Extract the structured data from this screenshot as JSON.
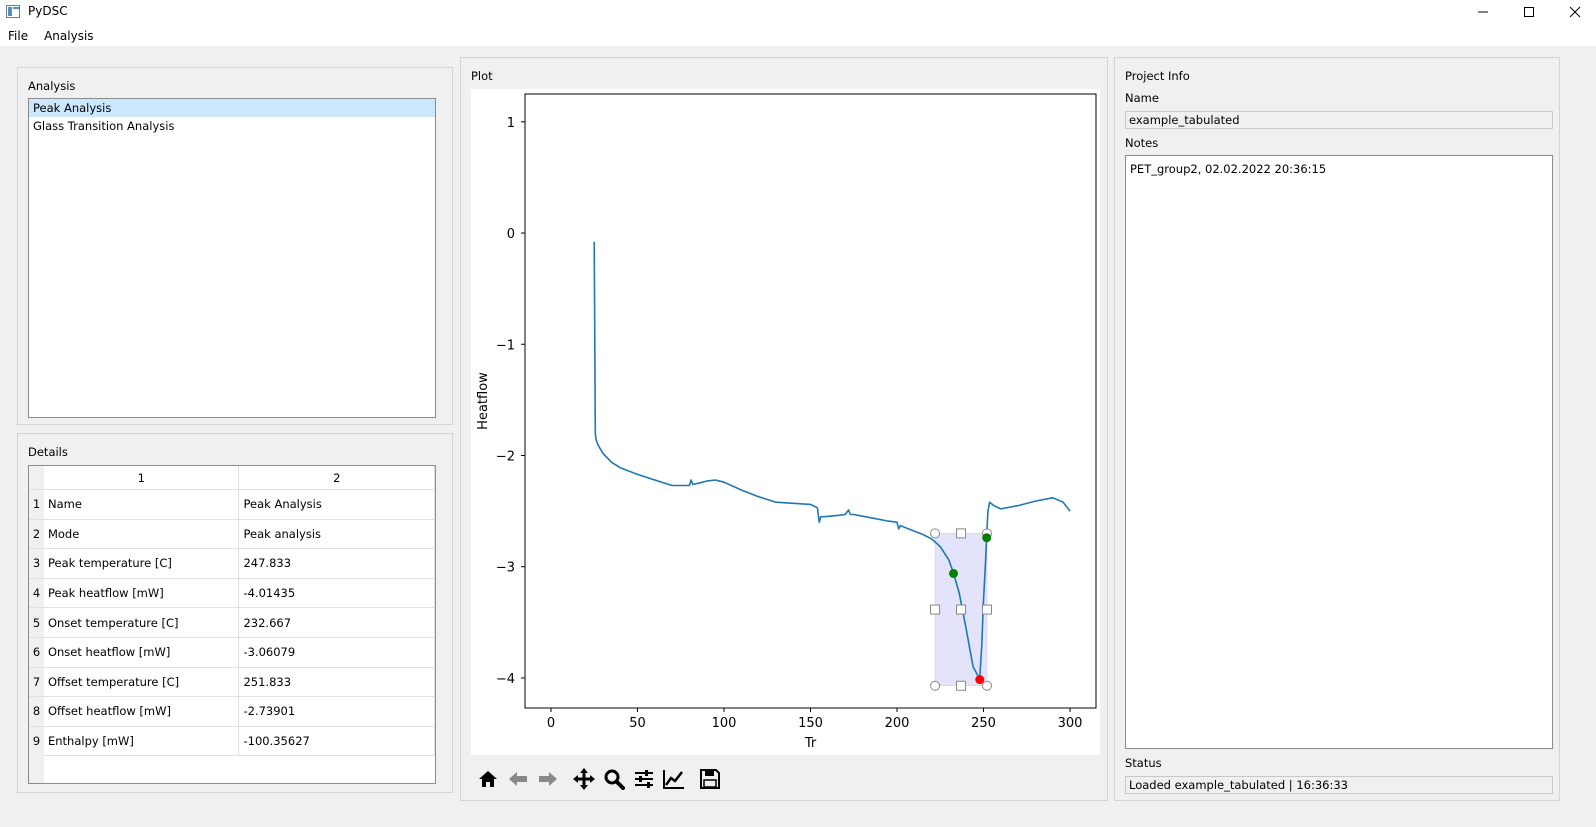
{
  "window": {
    "title": "PyDSC",
    "minimize_glyph": "—",
    "maximize_glyph": "☐",
    "close_glyph": "✕"
  },
  "menu": [
    "File",
    "Analysis"
  ],
  "analysis_panel": {
    "label": "Analysis",
    "items": [
      {
        "label": "Peak Analysis",
        "selected": true
      },
      {
        "label": "Glass Transition Analysis",
        "selected": false
      }
    ]
  },
  "details_panel": {
    "label": "Details",
    "columns": [
      "1",
      "2"
    ],
    "rows": [
      {
        "num": "1",
        "key": "Name",
        "value": "Peak Analysis"
      },
      {
        "num": "2",
        "key": "Mode",
        "value": "Peak analysis"
      },
      {
        "num": "3",
        "key": "Peak temperature [C]",
        "value": "247.833"
      },
      {
        "num": "4",
        "key": "Peak heatflow [mW]",
        "value": "-4.01435"
      },
      {
        "num": "5",
        "key": "Onset temperature [C]",
        "value": "232.667"
      },
      {
        "num": "6",
        "key": "Onset heatflow [mW]",
        "value": "-3.06079"
      },
      {
        "num": "7",
        "key": "Offset temperature [C]",
        "value": "251.833"
      },
      {
        "num": "8",
        "key": "Offset heatflow [mW]",
        "value": "-2.73901"
      },
      {
        "num": "9",
        "key": "Enthalpy [mW]",
        "value": "-100.35627"
      }
    ]
  },
  "plot_panel": {
    "label": "Plot"
  },
  "chart_data": {
    "type": "line",
    "xlabel": "Tr",
    "ylabel": "Heatflow",
    "xlim": [
      -15,
      315
    ],
    "ylim": [
      -4.27,
      1.25
    ],
    "xticks": [
      0,
      50,
      100,
      150,
      200,
      250,
      300
    ],
    "yticks": [
      1,
      0,
      -1,
      -2,
      -3,
      -4
    ],
    "line_color": "#1f77b4",
    "series": [
      {
        "x": [
          25,
          25.3,
          25.6,
          26,
          27,
          30,
          35,
          40,
          50,
          60,
          70,
          80,
          81,
          82,
          85,
          90,
          95,
          100,
          110,
          120,
          130,
          140,
          150,
          154,
          155,
          156,
          158,
          165,
          170,
          172,
          173,
          175,
          185,
          195,
          200,
          201,
          202,
          205,
          210,
          215,
          220,
          225,
          230,
          232.7,
          236,
          240,
          244,
          247.8,
          249,
          250,
          251,
          251.8,
          252.5,
          253.5,
          256,
          260,
          270,
          280,
          290,
          296,
          300
        ],
        "y": [
          -0.08,
          -0.8,
          -1.8,
          -1.85,
          -1.9,
          -1.98,
          -2.06,
          -2.11,
          -2.17,
          -2.22,
          -2.27,
          -2.27,
          -2.22,
          -2.26,
          -2.25,
          -2.23,
          -2.22,
          -2.24,
          -2.31,
          -2.37,
          -2.42,
          -2.43,
          -2.44,
          -2.47,
          -2.6,
          -2.55,
          -2.55,
          -2.54,
          -2.53,
          -2.49,
          -2.53,
          -2.53,
          -2.56,
          -2.59,
          -2.6,
          -2.66,
          -2.63,
          -2.65,
          -2.68,
          -2.71,
          -2.75,
          -2.82,
          -2.94,
          -3.06,
          -3.24,
          -3.56,
          -3.9,
          -4.01,
          -3.7,
          -3.3,
          -3.0,
          -2.74,
          -2.5,
          -2.42,
          -2.45,
          -2.48,
          -2.45,
          -2.41,
          -2.38,
          -2.42,
          -2.5
        ]
      }
    ],
    "selection_region": {
      "x0": 222,
      "x1": 252,
      "y0": -4.07,
      "y1": -2.7,
      "fill": "#dcdcfa"
    },
    "markers": [
      {
        "x": 232.667,
        "y": -3.06079,
        "color": "#007f00"
      },
      {
        "x": 251.833,
        "y": -2.73901,
        "color": "#007f00"
      },
      {
        "x": 247.833,
        "y": -4.01435,
        "color": "#ff0000"
      }
    ]
  },
  "plot_toolbar": [
    "home-icon",
    "back-arrow-icon",
    "forward-arrow-icon",
    "pan-icon",
    "zoom-icon",
    "configure-subplots-icon",
    "edit-axis-icon",
    "save-icon"
  ],
  "project_info": {
    "label": "Project Info",
    "name_label": "Name",
    "name_value": "example_tabulated",
    "notes_label": "Notes",
    "notes_value": "PET_group2, 02.02.2022 20:36:15",
    "status_label": "Status",
    "status_value": "Loaded example_tabulated | 16:36:33"
  }
}
